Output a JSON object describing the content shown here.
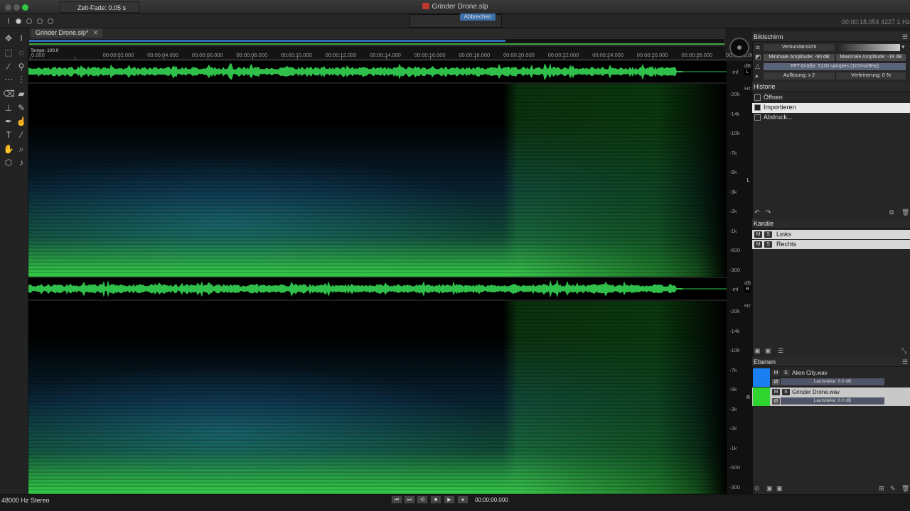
{
  "window": {
    "title": "Grinder Drone.slp"
  },
  "options": {
    "fade_label": "Zeit-Fade: 0.05 s",
    "abort_label": "Abbrechen",
    "position_readout": "00:00:18.054  4227.1 Hz"
  },
  "document": {
    "tab_label": "Grinder Drone.slp*",
    "close_glyph": "✕",
    "tempo_label": "Tempo: 100.0"
  },
  "ruler": {
    "labels": [
      "0.000",
      "00:00:02.000",
      "00:00:04.000",
      "00:00:06.000",
      "00:00:08.000",
      "00:00:10.000",
      "00:00:12.000",
      "00:00:14.000",
      "00:00:16.000",
      "00:00:18.000",
      "00:00:20.000",
      "00:00:22.000",
      "00:00:24.000",
      "00:00:26.000",
      "00:00:28.000",
      "00:00:30.000"
    ]
  },
  "tracks": {
    "db_label": "dB",
    "inf_label": "-inf",
    "hz_label": "Hz",
    "freq_labels": [
      "-20k",
      "-14k",
      "-10k",
      "-7k",
      "-5k",
      "-3k",
      "-2k",
      "-1k",
      "-600",
      "-300"
    ],
    "left_letter": "L",
    "right_letter": "R"
  },
  "panels": {
    "display": {
      "title": "Bildschirm",
      "view_label": "Verbundansicht",
      "min_amp": "Minimale Amplitude: -90 dB",
      "max_amp": "Maximale Amplitude: -18 dB",
      "fft": "FFT-Größe: 5120 samples (107ms/9Hz)",
      "resolution": "Auflösung: x 2",
      "refinement": "Verfeinerung: 0 %"
    },
    "history": {
      "title": "Historie",
      "items": [
        "Öffnen",
        "Importieren",
        "Abdruck..."
      ]
    },
    "channels": {
      "title": "Kanäle",
      "items": [
        "Links",
        "Rechts"
      ]
    },
    "layers": {
      "title": "Ebenen",
      "items": [
        {
          "name": "Alien City.wav",
          "volume": "Lautstärke: 0.0 dB",
          "color": "#1a7ff0"
        },
        {
          "name": "Grinder Drone.wav",
          "volume": "Lautstärke: 0.0 dB",
          "color": "#2fd42f"
        }
      ]
    }
  },
  "transport": {
    "timecode": "00:00:00.000"
  },
  "status": {
    "format": "48000 Hz Stereo"
  },
  "colors": {
    "spectrum_green": "#2fe34a",
    "spectrum_blue": "#1a5a8a",
    "accent_blue": "#3a6ea8"
  }
}
